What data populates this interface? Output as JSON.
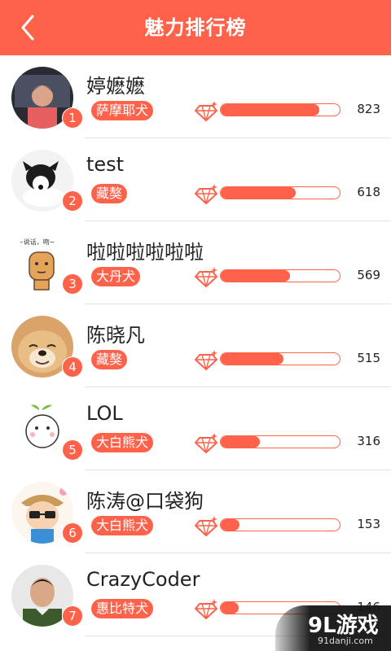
{
  "header": {
    "title": "魅力排行榜",
    "back_icon": "chevron-left-icon"
  },
  "accent_color": "#fe624b",
  "rows": [
    {
      "rank": "1",
      "name": "婷嬷嬷",
      "breed": "萨摩耶犬",
      "score": "823",
      "level": 0.83
    },
    {
      "rank": "2",
      "name": "test",
      "breed": "藏獒",
      "score": "618",
      "level": 0.63
    },
    {
      "rank": "3",
      "name": "啦啦啦啦啦啦",
      "breed": "大丹犬",
      "score": "569",
      "level": 0.58
    },
    {
      "rank": "4",
      "name": "陈晓凡",
      "breed": "藏獒",
      "score": "515",
      "level": 0.53
    },
    {
      "rank": "5",
      "name": "LOL",
      "breed": "大白熊犬",
      "score": "316",
      "level": 0.33
    },
    {
      "rank": "6",
      "name": "陈涛@口袋狗",
      "breed": "大白熊犬",
      "score": "153",
      "level": 0.16
    },
    {
      "rank": "7",
      "name": "CrazyCoder",
      "breed": "惠比特犬",
      "score": "146",
      "level": 0.15
    }
  ],
  "watermark": {
    "main": "9L游戏",
    "sub": "91danji.com"
  }
}
